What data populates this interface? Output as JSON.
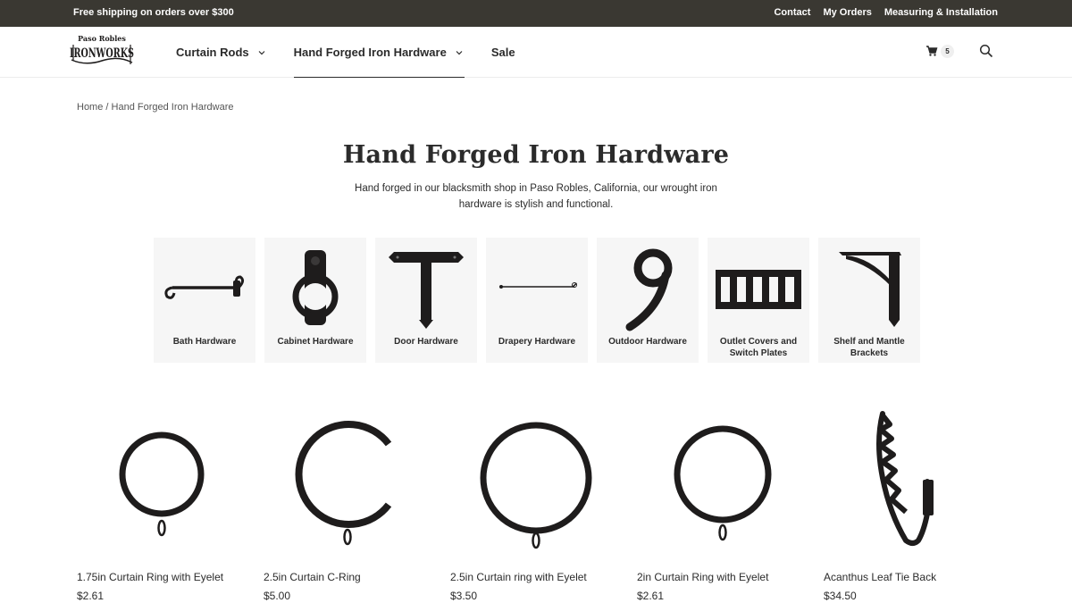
{
  "topbar": {
    "promo": "Free shipping on orders over $300",
    "links": [
      "Contact",
      "My Orders",
      "Measuring & Installation"
    ]
  },
  "header": {
    "logo_text_top": "Paso Robles",
    "logo_text_main": "IRONWORKS",
    "nav": [
      {
        "label": "Curtain Rods",
        "dropdown": true,
        "active": false
      },
      {
        "label": "Hand Forged Iron Hardware",
        "dropdown": true,
        "active": true
      },
      {
        "label": "Sale",
        "dropdown": false,
        "active": false
      }
    ],
    "cart_count": "5",
    "icons": [
      "cart-icon",
      "search-icon",
      "chevron-down-icon"
    ]
  },
  "breadcrumb": {
    "home": "Home",
    "separator": "/",
    "current": "Hand Forged Iron Hardware"
  },
  "page": {
    "title": "Hand Forged Iron Hardware",
    "description": "Hand forged in our blacksmith shop in Paso Robles, California, our wrought iron hardware is stylish and functional."
  },
  "categories": [
    {
      "label": "Bath Hardware",
      "icon": "towel-bar-icon"
    },
    {
      "label": "Cabinet Hardware",
      "icon": "ring-pull-icon"
    },
    {
      "label": "Door Hardware",
      "icon": "t-strap-hinge-icon"
    },
    {
      "label": "Drapery Hardware",
      "icon": "drapery-rod-icon"
    },
    {
      "label": "Outdoor Hardware",
      "icon": "house-number-icon"
    },
    {
      "label": "Outlet Covers and Switch Plates",
      "icon": "switch-plate-icon"
    },
    {
      "label": "Shelf and Mantle Brackets",
      "icon": "shelf-bracket-icon"
    }
  ],
  "products": [
    {
      "name": "1.75in Curtain Ring with Eyelet",
      "price": "$2.61",
      "icon": "curtain-ring-icon"
    },
    {
      "name": "2.5in Curtain C-Ring",
      "price": "$5.00",
      "icon": "c-ring-icon"
    },
    {
      "name": "2.5in Curtain ring with Eyelet",
      "price": "$3.50",
      "icon": "curtain-ring-icon"
    },
    {
      "name": "2in Curtain Ring with Eyelet",
      "price": "$2.61",
      "icon": "curtain-ring-icon"
    },
    {
      "name": "Acanthus Leaf Tie Back",
      "price": "$34.50",
      "icon": "tie-back-icon"
    }
  ],
  "colors": {
    "topbar_bg": "#3a3832",
    "text": "#2b2b2b",
    "tile_bg": "#f6f6f6",
    "iron": "#1e1c1c"
  }
}
